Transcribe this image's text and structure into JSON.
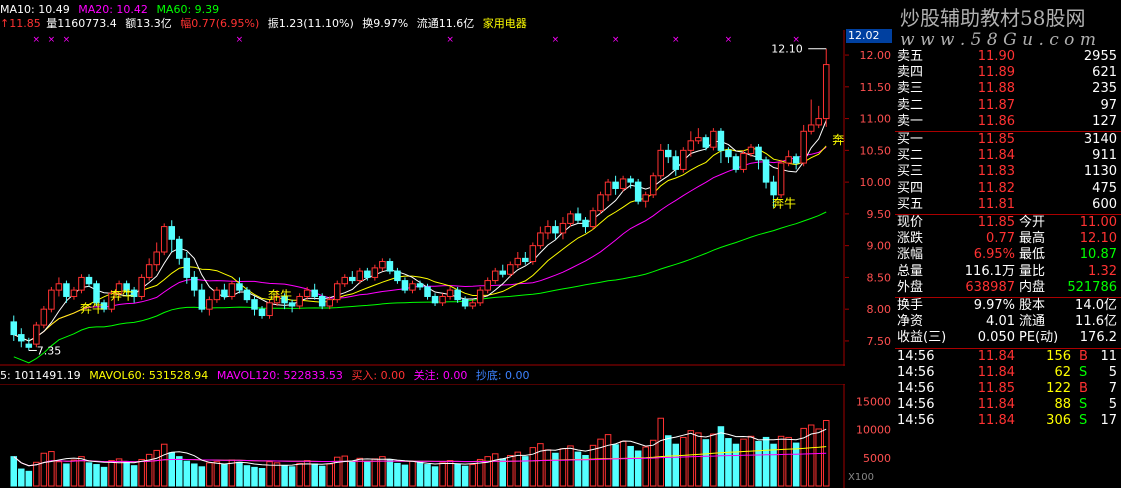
{
  "indicators": {
    "ma10": "MA10: 10.49",
    "ma20": "MA20: 10.42",
    "ma60": "MA60: 9.39"
  },
  "info": {
    "prefix": "↑11.85",
    "volume": "量1160773.4",
    "amount": "额13.3亿",
    "change": "幅0.77(6.95%)",
    "amplitude": "振1.23(11.10%)",
    "turnover": "换9.97%",
    "float": "流通11.6亿",
    "sector": "家用电器"
  },
  "vol_indicators": {
    "mavol5": "5: 1011491.19",
    "mavol60": "MAVOL60: 531528.94",
    "mavol120": "MAVOL120: 522833.53",
    "buy": "买入: 0.00",
    "watch": "关注: 0.00",
    "bottom": "抄底: 0.00"
  },
  "watermark": {
    "line1": "炒股辅助教材58股网",
    "line2": "w w w . 5 8 G u . c o m"
  },
  "price_badge": "12.02",
  "price_ticks": [
    "12.00",
    "11.50",
    "11.00",
    "10.50",
    "10.00",
    "9.50",
    "9.00",
    "8.50",
    "8.00",
    "7.50"
  ],
  "vol_ticks": [
    "15000",
    "10000",
    "5000"
  ],
  "vol_unit": "X100",
  "chart_labels": {
    "high": "12.10",
    "low": "7.35",
    "bull": "奔牛"
  },
  "orderbook": {
    "sell": [
      {
        "label": "卖五",
        "price": "11.90",
        "vol": "2955"
      },
      {
        "label": "卖四",
        "price": "11.89",
        "vol": "621"
      },
      {
        "label": "卖三",
        "price": "11.88",
        "vol": "235"
      },
      {
        "label": "卖二",
        "price": "11.87",
        "vol": "97"
      },
      {
        "label": "卖一",
        "price": "11.86",
        "vol": "127"
      }
    ],
    "buy": [
      {
        "label": "买一",
        "price": "11.85",
        "vol": "3140"
      },
      {
        "label": "买二",
        "price": "11.84",
        "vol": "911"
      },
      {
        "label": "买三",
        "price": "11.83",
        "vol": "1130"
      },
      {
        "label": "买四",
        "price": "11.82",
        "vol": "475"
      },
      {
        "label": "买五",
        "price": "11.81",
        "vol": "600"
      }
    ]
  },
  "quote": [
    {
      "l1": "现价",
      "v1": "11.85",
      "l2": "今开",
      "v2": "11.00"
    },
    {
      "l1": "涨跌",
      "v1": "0.77",
      "l2": "最高",
      "v2": "12.10"
    },
    {
      "l1": "涨幅",
      "v1": "6.95%",
      "l2": "最低",
      "v2": "10.87"
    },
    {
      "l1": "总量",
      "v1": "116.1万",
      "l2": "量比",
      "v2": "1.32"
    },
    {
      "l1": "外盘",
      "v1": "638987",
      "l2": "内盘",
      "v2": "521786"
    }
  ],
  "fundamentals": [
    {
      "l1": "换手",
      "v1": "9.97%",
      "l2": "股本",
      "v2": "14.0亿"
    },
    {
      "l1": "净资",
      "v1": "4.01",
      "l2": "流通",
      "v2": "11.6亿"
    },
    {
      "l1": "收益(三)",
      "v1": "0.050",
      "l2": "PE(动)",
      "v2": "176.2"
    }
  ],
  "ticks": [
    {
      "time": "14:56",
      "price": "11.84",
      "vol": "156",
      "side": "B",
      "n": "11"
    },
    {
      "time": "14:56",
      "price": "11.84",
      "vol": "62",
      "side": "S",
      "n": "5"
    },
    {
      "time": "14:56",
      "price": "11.85",
      "vol": "122",
      "side": "B",
      "n": "7"
    },
    {
      "time": "14:56",
      "price": "11.84",
      "vol": "88",
      "side": "S",
      "n": "5"
    },
    {
      "time": "14:56",
      "price": "11.84",
      "vol": "306",
      "side": "S",
      "n": "17"
    }
  ],
  "colors": {
    "up": "#ff3232",
    "down": "#54ffff",
    "ma5": "#ffffff",
    "ma10": "#ffff00",
    "ma20": "#ff00ff",
    "ma60": "#00ff00",
    "label": "#ff5050",
    "yellow": "#ffff00",
    "grid": "#a00000"
  },
  "chart_data": {
    "type": "candlestick",
    "ylim": [
      7.2,
      12.3
    ],
    "candles": [
      [
        7.8,
        7.6,
        7.9,
        7.5
      ],
      [
        7.6,
        7.5,
        7.7,
        7.4
      ],
      [
        7.45,
        7.4,
        7.55,
        7.35
      ],
      [
        7.45,
        7.75,
        7.8,
        7.4
      ],
      [
        7.75,
        8.0,
        8.05,
        7.7
      ],
      [
        8.0,
        8.3,
        8.35,
        7.95
      ],
      [
        8.3,
        8.4,
        8.5,
        8.2
      ],
      [
        8.4,
        8.2,
        8.45,
        8.1
      ],
      [
        8.2,
        8.3,
        8.35,
        8.15
      ],
      [
        8.3,
        8.5,
        8.55,
        8.25
      ],
      [
        8.5,
        8.4,
        8.55,
        8.35
      ],
      [
        8.4,
        8.1,
        8.45,
        8.05
      ],
      [
        8.1,
        8.0,
        8.15,
        7.95
      ],
      [
        8.0,
        8.25,
        8.3,
        7.95
      ],
      [
        8.25,
        8.4,
        8.45,
        8.2
      ],
      [
        8.4,
        8.3,
        8.45,
        8.2
      ],
      [
        8.3,
        8.2,
        8.35,
        8.1
      ],
      [
        8.2,
        8.5,
        8.55,
        8.15
      ],
      [
        8.5,
        8.7,
        8.8,
        8.45
      ],
      [
        8.7,
        8.9,
        9.05,
        8.6
      ],
      [
        8.9,
        9.3,
        9.35,
        8.85
      ],
      [
        9.3,
        9.1,
        9.4,
        8.9
      ],
      [
        9.1,
        8.8,
        9.15,
        8.7
      ],
      [
        8.8,
        8.5,
        8.9,
        8.4
      ],
      [
        8.5,
        8.3,
        8.6,
        8.2
      ],
      [
        8.3,
        8.0,
        8.4,
        7.95
      ],
      [
        8.0,
        8.15,
        8.2,
        7.9
      ],
      [
        8.15,
        8.3,
        8.35,
        8.1
      ],
      [
        8.3,
        8.2,
        8.4,
        8.15
      ],
      [
        8.2,
        8.4,
        8.45,
        8.15
      ],
      [
        8.4,
        8.3,
        8.5,
        8.25
      ],
      [
        8.3,
        8.15,
        8.35,
        8.1
      ],
      [
        8.15,
        8.0,
        8.2,
        7.9
      ],
      [
        8.0,
        7.9,
        8.05,
        7.85
      ],
      [
        7.9,
        8.1,
        8.15,
        7.85
      ],
      [
        8.1,
        8.2,
        8.3,
        8.05
      ],
      [
        8.2,
        8.1,
        8.25,
        8.0
      ],
      [
        8.1,
        8.05,
        8.15,
        7.95
      ],
      [
        8.05,
        8.2,
        8.25,
        8.0
      ],
      [
        8.2,
        8.3,
        8.35,
        8.15
      ],
      [
        8.3,
        8.2,
        8.4,
        8.15
      ],
      [
        8.2,
        8.05,
        8.25,
        8.0
      ],
      [
        8.05,
        8.15,
        8.2,
        8.0
      ],
      [
        8.15,
        8.4,
        8.45,
        8.1
      ],
      [
        8.4,
        8.5,
        8.55,
        8.35
      ],
      [
        8.5,
        8.45,
        8.6,
        8.4
      ],
      [
        8.45,
        8.6,
        8.65,
        8.4
      ],
      [
        8.6,
        8.5,
        8.65,
        8.45
      ],
      [
        8.5,
        8.65,
        8.7,
        8.45
      ],
      [
        8.65,
        8.75,
        8.8,
        8.6
      ],
      [
        8.75,
        8.6,
        8.8,
        8.55
      ],
      [
        8.6,
        8.45,
        8.65,
        8.4
      ],
      [
        8.45,
        8.3,
        8.5,
        8.25
      ],
      [
        8.3,
        8.4,
        8.45,
        8.25
      ],
      [
        8.4,
        8.35,
        8.45,
        8.3
      ],
      [
        8.35,
        8.2,
        8.4,
        8.15
      ],
      [
        8.2,
        8.1,
        8.25,
        8.05
      ],
      [
        8.1,
        8.2,
        8.25,
        8.05
      ],
      [
        8.2,
        8.3,
        8.35,
        8.15
      ],
      [
        8.3,
        8.15,
        8.35,
        8.1
      ],
      [
        8.15,
        8.05,
        8.2,
        8.0
      ],
      [
        8.05,
        8.1,
        8.15,
        8.0
      ],
      [
        8.1,
        8.3,
        8.35,
        8.05
      ],
      [
        8.3,
        8.45,
        8.5,
        8.25
      ],
      [
        8.45,
        8.6,
        8.65,
        8.4
      ],
      [
        8.6,
        8.55,
        8.7,
        8.5
      ],
      [
        8.55,
        8.7,
        8.75,
        8.5
      ],
      [
        8.7,
        8.8,
        8.9,
        8.65
      ],
      [
        8.8,
        8.75,
        8.9,
        8.7
      ],
      [
        8.75,
        9.0,
        9.05,
        8.7
      ],
      [
        9.0,
        9.2,
        9.3,
        8.95
      ],
      [
        9.2,
        9.3,
        9.4,
        9.1
      ],
      [
        9.3,
        9.2,
        9.4,
        9.1
      ],
      [
        9.2,
        9.35,
        9.45,
        9.1
      ],
      [
        9.35,
        9.5,
        9.55,
        9.3
      ],
      [
        9.5,
        9.4,
        9.6,
        9.35
      ],
      [
        9.4,
        9.3,
        9.45,
        9.2
      ],
      [
        9.3,
        9.55,
        9.6,
        9.25
      ],
      [
        9.55,
        9.8,
        9.85,
        9.5
      ],
      [
        9.8,
        10.0,
        10.05,
        9.7
      ],
      [
        10.0,
        9.9,
        10.1,
        9.8
      ],
      [
        9.9,
        10.05,
        10.1,
        9.85
      ],
      [
        10.05,
        10.0,
        10.1,
        9.9
      ],
      [
        10.0,
        9.7,
        10.05,
        9.65
      ],
      [
        9.7,
        9.8,
        9.85,
        9.6
      ],
      [
        9.8,
        10.1,
        10.15,
        9.75
      ],
      [
        10.1,
        10.5,
        10.6,
        10.05
      ],
      [
        10.5,
        10.4,
        10.6,
        10.3
      ],
      [
        10.4,
        10.2,
        10.5,
        10.1
      ],
      [
        10.2,
        10.5,
        10.55,
        10.15
      ],
      [
        10.5,
        10.65,
        10.8,
        10.4
      ],
      [
        10.65,
        10.7,
        10.85,
        10.6
      ],
      [
        10.7,
        10.55,
        10.75,
        10.5
      ],
      [
        10.55,
        10.8,
        10.85,
        10.5
      ],
      [
        10.8,
        10.5,
        10.85,
        10.3
      ],
      [
        10.5,
        10.4,
        10.55,
        10.3
      ],
      [
        10.4,
        10.2,
        10.45,
        10.15
      ],
      [
        10.2,
        10.45,
        10.5,
        10.15
      ],
      [
        10.45,
        10.55,
        10.6,
        10.4
      ],
      [
        10.55,
        10.35,
        10.6,
        10.2
      ],
      [
        10.35,
        10.0,
        10.4,
        9.9
      ],
      [
        10.0,
        9.8,
        10.1,
        9.6
      ],
      [
        9.8,
        10.3,
        10.35,
        9.75
      ],
      [
        10.3,
        10.4,
        10.5,
        10.25
      ],
      [
        10.4,
        10.3,
        10.45,
        10.2
      ],
      [
        10.3,
        10.8,
        10.9,
        10.25
      ],
      [
        10.8,
        10.9,
        11.3,
        10.75
      ],
      [
        10.9,
        11.0,
        11.2,
        10.85
      ],
      [
        11.0,
        11.85,
        12.1,
        10.87
      ]
    ],
    "volumes": [
      5200,
      3000,
      2600,
      4200,
      5800,
      6100,
      4300,
      3900,
      4600,
      5200,
      4100,
      3800,
      3300,
      4500,
      4800,
      4300,
      3600,
      4700,
      5600,
      6300,
      7400,
      5900,
      5200,
      4400,
      3900,
      3400,
      4100,
      4300,
      3800,
      4600,
      4200,
      3600,
      3300,
      3100,
      4300,
      4100,
      3600,
      3400,
      4000,
      4500,
      3900,
      3500,
      3900,
      5100,
      5300,
      4400,
      4900,
      4300,
      4800,
      5200,
      4600,
      4000,
      3700,
      4400,
      4200,
      3800,
      3400,
      4100,
      4500,
      3900,
      3500,
      3800,
      4700,
      5200,
      5700,
      4800,
      5400,
      6000,
      5200,
      6800,
      7500,
      6400,
      5800,
      6600,
      7100,
      6000,
      5400,
      7200,
      8300,
      9100,
      7300,
      7900,
      7000,
      6200,
      6900,
      8100,
      12000,
      8900,
      7400,
      8600,
      9800,
      9400,
      8200,
      9200,
      10500,
      8400,
      7400,
      8300,
      8800,
      7900,
      8600,
      7400,
      8800,
      8600,
      7600,
      10200,
      10800,
      10100,
      11600
    ]
  }
}
